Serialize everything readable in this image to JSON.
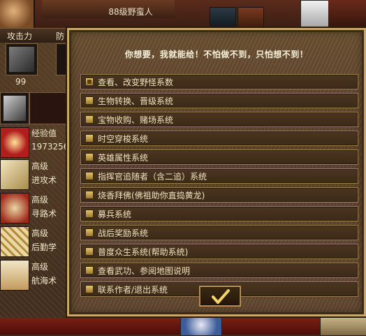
{
  "hero": {
    "class_text": "88级野蛮人",
    "attack_label": "攻击力",
    "defense_label": "防",
    "attack_value": "99"
  },
  "stats": {
    "exp_label": "经验值",
    "exp_value": "1973256"
  },
  "skills": [
    {
      "level": "高级",
      "name": "进攻术",
      "icon": "sword-icon"
    },
    {
      "level": "高级",
      "name": "寻路术",
      "icon": "map-icon"
    },
    {
      "level": "高级",
      "name": "后勤学",
      "icon": "path-icon"
    },
    {
      "level": "高级",
      "name": "航海术",
      "icon": "ship-icon"
    }
  ],
  "dialog": {
    "title": "你想要，我就能给！不怕做不到，只怕想不到！",
    "items": [
      {
        "label": "查看、改变野怪系数",
        "checked": true
      },
      {
        "label": "生物转换、晋级系统",
        "checked": false
      },
      {
        "label": "宝物收购、赌场系统",
        "checked": false
      },
      {
        "label": "时空穿梭系统",
        "checked": false
      },
      {
        "label": "英雄属性系统",
        "checked": false
      },
      {
        "label": "指挥官追随者（含二追）系统",
        "checked": false
      },
      {
        "label": "烧香拜佛(佛祖助你直捣黄龙)",
        "checked": false
      },
      {
        "label": "募兵系统",
        "checked": false
      },
      {
        "label": "战后奖励系统",
        "checked": false
      },
      {
        "label": "普度众生系统(帮助系统)",
        "checked": false
      },
      {
        "label": "查看武功、参阅地图说明",
        "checked": false
      },
      {
        "label": "联系作者/退出系统",
        "checked": false
      }
    ],
    "ok_icon": "checkmark-icon"
  },
  "colors": {
    "dialog_bg": "#5a4029",
    "dialog_border": "#c9a86a",
    "menu_text": "#efe3be",
    "checkbox": "#d9b75a"
  }
}
